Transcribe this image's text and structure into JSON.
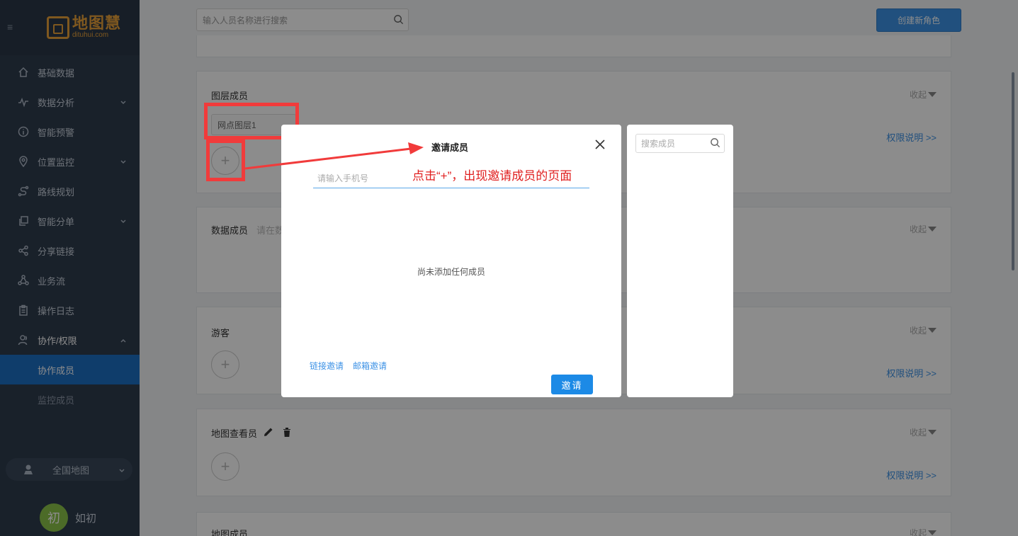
{
  "sidebar": {
    "logo": {
      "name": "地图慧",
      "sub": "dituhui.com"
    },
    "items": [
      {
        "label": "基础数据",
        "icon": "home-icon",
        "has_chevron": false
      },
      {
        "label": "数据分析",
        "icon": "chart-line-icon",
        "has_chevron": true
      },
      {
        "label": "智能预警",
        "icon": "info-circle-icon",
        "has_chevron": false
      },
      {
        "label": "位置监控",
        "icon": "location-pin-icon",
        "has_chevron": true
      },
      {
        "label": "路线规划",
        "icon": "route-icon",
        "has_chevron": false
      },
      {
        "label": "智能分单",
        "icon": "copy-icon",
        "has_chevron": true
      },
      {
        "label": "分享链接",
        "icon": "share-icon",
        "has_chevron": false
      },
      {
        "label": "业务流",
        "icon": "workflow-icon",
        "has_chevron": false
      },
      {
        "label": "操作日志",
        "icon": "clipboard-icon",
        "has_chevron": false
      },
      {
        "label": "协作/权限",
        "icon": "user-icon",
        "has_chevron": true
      }
    ],
    "sub_items": [
      {
        "label": "协作成员",
        "active": true
      },
      {
        "label": "监控成员",
        "active": false
      }
    ],
    "map_switch": "全国地图",
    "user": {
      "avatar_char": "初",
      "name": "如初"
    }
  },
  "header": {
    "search_placeholder": "输入人员名称进行搜索",
    "create_button": "创建新角色"
  },
  "cards": {
    "layer_members": {
      "title": "图层成员",
      "tag": "网点图层1",
      "collapse": "收起",
      "perm": "权限说明 >>"
    },
    "data_members": {
      "title": "数据成员",
      "hint": "请在数",
      "collapse": "收起"
    },
    "visitors": {
      "title": "游客",
      "collapse": "收起",
      "perm": "权限说明 >>"
    },
    "map_viewer": {
      "title": "地图查看员",
      "collapse": "收起",
      "perm": "权限说明 >>"
    },
    "map_member": {
      "title": "地图成员",
      "collapse": "收起"
    }
  },
  "plus_symbol": "+",
  "dialog": {
    "title": "邀请成员",
    "phone_placeholder": "请输入手机号",
    "empty_text": "尚未添加任何成员",
    "link_invite": "链接邀请",
    "email_invite": "邮箱邀请",
    "invite_button": "邀请"
  },
  "side_panel": {
    "search_placeholder": "搜索成员"
  },
  "annotation": "点击“+”，出现邀请成员的页面",
  "colors": {
    "sidebar_bg": "#2f3c4e",
    "active": "#1d6fc4",
    "accent": "#3d92e6",
    "annotation": "#e02020"
  }
}
